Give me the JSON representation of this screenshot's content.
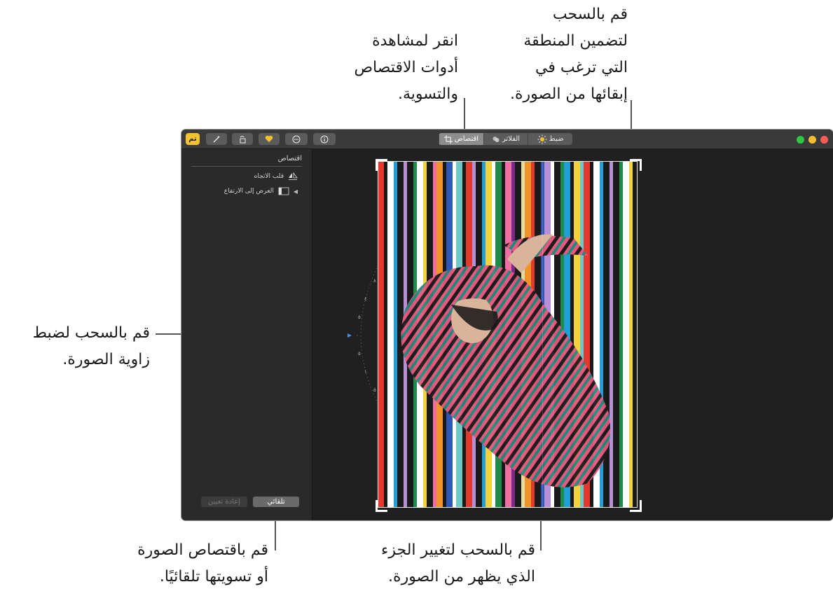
{
  "callouts": {
    "top_right": [
      "قم بالسحب",
      "لتضمين المنطقة",
      "التي ترغب في",
      "إبقائها من الصورة."
    ],
    "top_middle": [
      "انقر لمشاهدة",
      "أدوات الاقتصاص",
      "والتسوية."
    ],
    "left": [
      "قم بالسحب لضبط",
      "زاوية الصورة."
    ],
    "bottom_left": [
      "قم باقتصاص الصورة",
      "أو تسويتها تلقائيًا."
    ],
    "bottom_right": [
      "قم بالسحب لتغيير الجزء",
      "الذي يظهر من الصورة."
    ]
  },
  "toolbar": {
    "done_label": "تم",
    "tabs": [
      {
        "label": "ضبط",
        "icon": "adjust-sun-icon"
      },
      {
        "label": "الفلاتر",
        "icon": "filters-icon"
      },
      {
        "label": "اقتصاص",
        "icon": "crop-icon",
        "active": true
      }
    ],
    "left_icons": [
      "magic-wand-icon",
      "rotate-icon",
      "heart-icon",
      "more-icon",
      "info-icon"
    ]
  },
  "sidebar": {
    "title": "اقتصاص",
    "items": [
      {
        "label": "قلب الاتجاه",
        "icon": "flip-icon"
      },
      {
        "label": "العرض إلى الارتفاع",
        "icon": "aspect-icon"
      }
    ],
    "auto_button": "تلقائي",
    "reset_button": "إعادة تعيين"
  },
  "dial": {
    "labels": [
      "٨",
      "٤",
      "٥",
      "٠",
      "٥",
      "١",
      "٥"
    ]
  },
  "colors": {
    "accent": "#f2c230",
    "stripes": [
      "#e43a2e",
      "#1a1a1a",
      "#ffffff",
      "#1f9fd6",
      "#b68fd6",
      "#1f8a4c",
      "#f4d23a",
      "#ee6fa2",
      "#f2932a",
      "#2f56b4",
      "#6fc7c7",
      "#7a2a8a",
      "#e8d9a0"
    ]
  }
}
